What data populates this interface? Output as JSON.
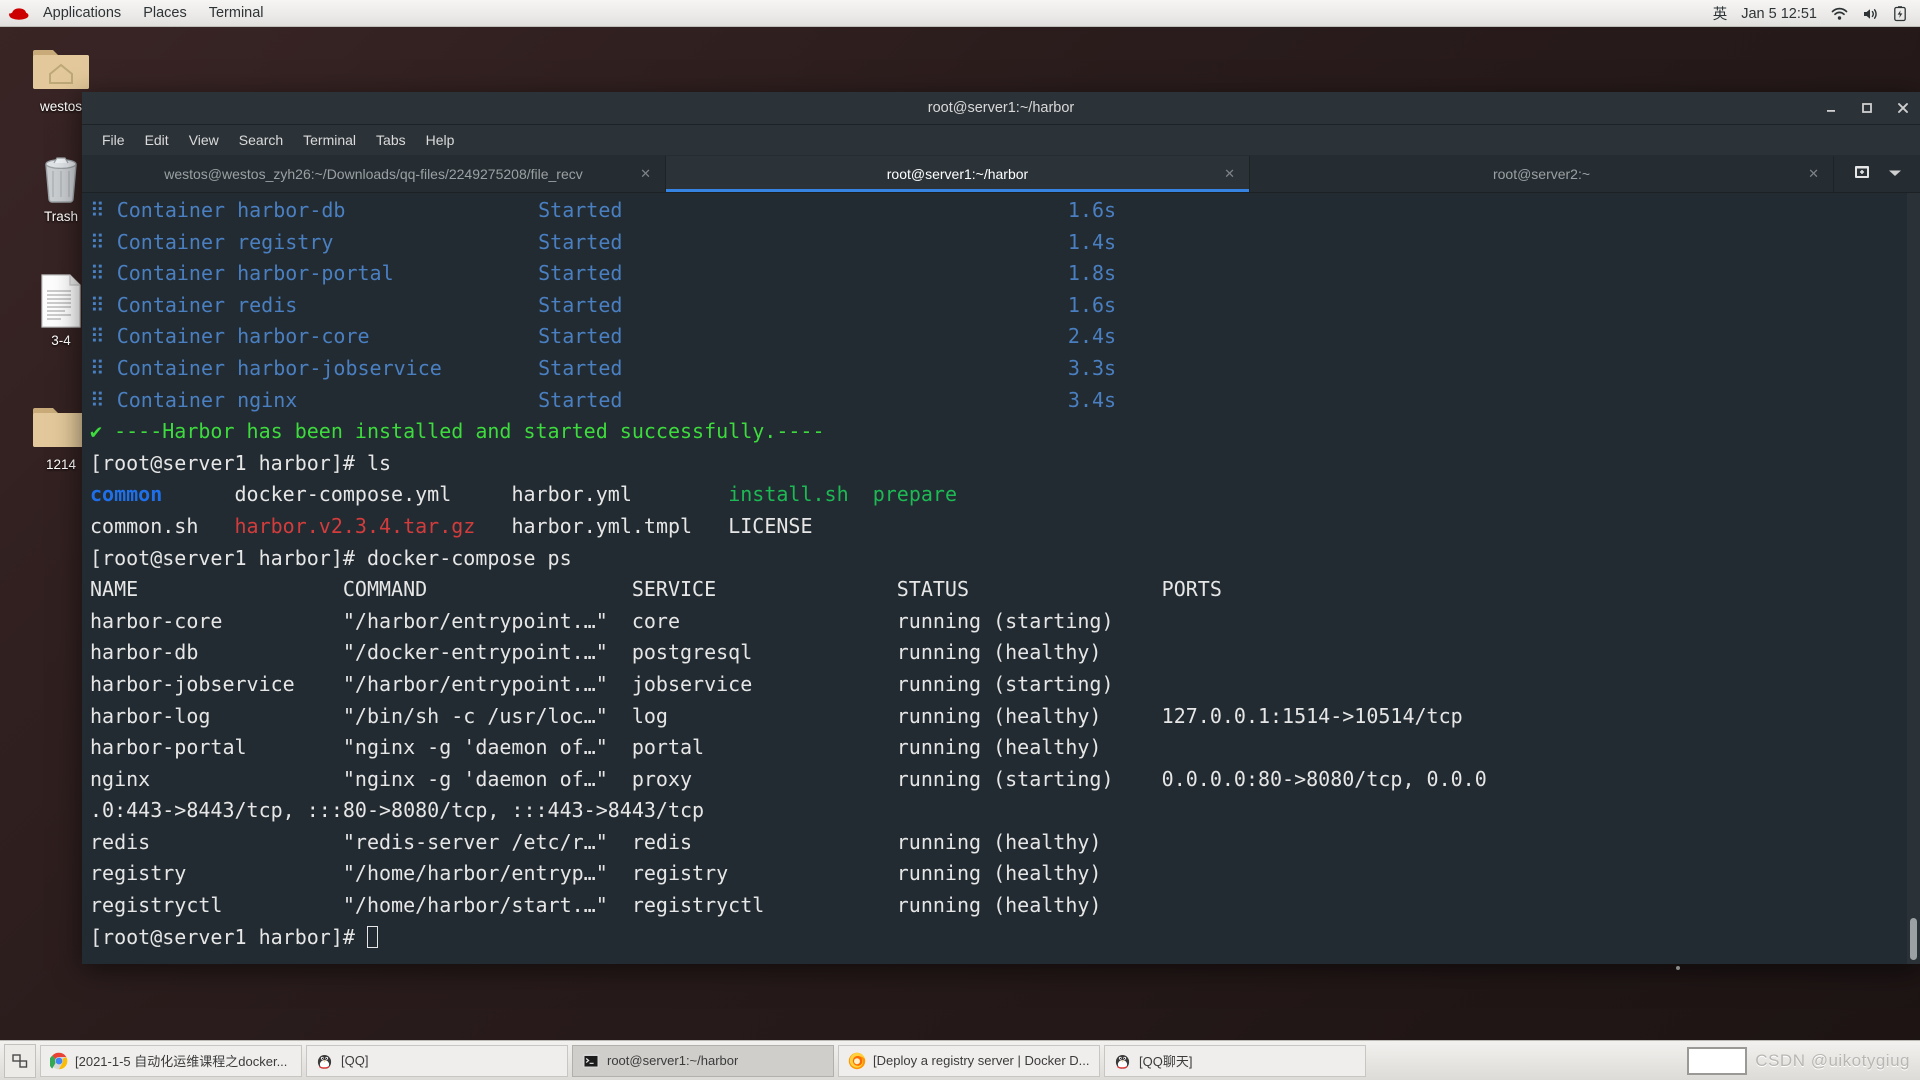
{
  "top_panel": {
    "logo_icon": "redhat-logo-icon",
    "menus": [
      "Applications",
      "Places",
      "Terminal"
    ],
    "input_method": "英",
    "clock": "Jan 5  12:51",
    "tray_icons": [
      "wifi-icon",
      "volume-icon",
      "battery-icon"
    ]
  },
  "desktop_icons": [
    {
      "label": "westos",
      "icon": "home-folder-icon"
    },
    {
      "label": "Trash",
      "icon": "trash-icon"
    },
    {
      "label": "3-4",
      "icon": "document-icon"
    },
    {
      "label": "1214",
      "icon": "folder-icon"
    }
  ],
  "window": {
    "title": "root@server1:~/harbor",
    "controls": {
      "minimize": "—",
      "maximize": "□",
      "close": "✕"
    },
    "menu_bar": [
      "File",
      "Edit",
      "View",
      "Search",
      "Terminal",
      "Tabs",
      "Help"
    ],
    "tabs": [
      {
        "label": "westos@westos_zyh26:~/Downloads/qq-files/2249275208/file_recv",
        "active": false,
        "close": "✕"
      },
      {
        "label": "root@server1:~/harbor",
        "active": true,
        "close": "✕"
      },
      {
        "label": "root@server2:~",
        "active": false,
        "close": "✕"
      }
    ],
    "tab_actions": [
      "new-tab-icon",
      "tab-list-chevron-icon"
    ]
  },
  "terminal": {
    "compose_up": [
      {
        "glyph": "⠿",
        "name": "Container harbor-db",
        "status": "Started",
        "time": "1.6s"
      },
      {
        "glyph": "⠿",
        "name": "Container registry",
        "status": "Started",
        "time": "1.4s"
      },
      {
        "glyph": "⠿",
        "name": "Container harbor-portal",
        "status": "Started",
        "time": "1.8s"
      },
      {
        "glyph": "⠿",
        "name": "Container redis",
        "status": "Started",
        "time": "1.6s"
      },
      {
        "glyph": "⠿",
        "name": "Container harbor-core",
        "status": "Started",
        "time": "2.4s"
      },
      {
        "glyph": "⠿",
        "name": "Container harbor-jobservice",
        "status": "Started",
        "time": "3.3s"
      },
      {
        "glyph": "⠿",
        "name": "Container nginx",
        "status": "Started",
        "time": "3.4s"
      }
    ],
    "success_line": {
      "check": "✔",
      "text": "----Harbor has been installed and started successfully.----"
    },
    "prompt": "[root@server1 harbor]#",
    "cmd_ls": "ls",
    "ls_row1": [
      {
        "text": "common",
        "color": "dir"
      },
      {
        "text": "docker-compose.yml",
        "color": "plain"
      },
      {
        "text": "harbor.yml",
        "color": "plain"
      },
      {
        "text": "install.sh",
        "color": "exec"
      },
      {
        "text": "prepare",
        "color": "exec"
      }
    ],
    "ls_row2": [
      {
        "text": "common.sh",
        "color": "plain"
      },
      {
        "text": "harbor.v2.3.4.tar.gz",
        "color": "archive"
      },
      {
        "text": "harbor.yml.tmpl",
        "color": "plain"
      },
      {
        "text": "LICENSE",
        "color": "plain"
      }
    ],
    "cmd_ps": "docker-compose ps",
    "ps_headers": [
      "NAME",
      "COMMAND",
      "SERVICE",
      "STATUS",
      "PORTS"
    ],
    "ps_rows": [
      {
        "name": "harbor-core",
        "command": "\"/harbor/entrypoint.…\"",
        "service": "core",
        "status": "running (starting)",
        "ports": ""
      },
      {
        "name": "harbor-db",
        "command": "\"/docker-entrypoint.…\"",
        "service": "postgresql",
        "status": "running (healthy)",
        "ports": ""
      },
      {
        "name": "harbor-jobservice",
        "command": "\"/harbor/entrypoint.…\"",
        "service": "jobservice",
        "status": "running (starting)",
        "ports": ""
      },
      {
        "name": "harbor-log",
        "command": "\"/bin/sh -c /usr/loc…\"",
        "service": "log",
        "status": "running (healthy)",
        "ports": "127.0.0.1:1514->10514/tcp"
      },
      {
        "name": "harbor-portal",
        "command": "\"nginx -g 'daemon of…\"",
        "service": "portal",
        "status": "running (healthy)",
        "ports": ""
      },
      {
        "name": "nginx",
        "command": "\"nginx -g 'daemon of…\"",
        "service": "proxy",
        "status": "running (starting)",
        "ports": "0.0.0.0:80->8080/tcp, 0.0.0"
      },
      {
        "name": "redis",
        "command": "\"redis-server /etc/r…\"",
        "service": "redis",
        "status": "running (healthy)",
        "ports": ""
      },
      {
        "name": "registry",
        "command": "\"/home/harbor/entryp…\"",
        "service": "registry",
        "status": "running (healthy)",
        "ports": ""
      },
      {
        "name": "registryctl",
        "command": "\"/home/harbor/start.…\"",
        "service": "registryctl",
        "status": "running (healthy)",
        "ports": ""
      }
    ],
    "ports_wrap_line": ".0:443->8443/tcp, :::80->8080/tcp, :::443->8443/tcp",
    "final_prompt": "[root@server1 harbor]#"
  },
  "taskbar": {
    "show_desktop_icon": "show-desktop-icon",
    "buttons": [
      {
        "label": "[2021-1-5 自动化运维课程之docker...",
        "icon": "chrome-icon",
        "active": false
      },
      {
        "label": "[QQ]",
        "icon": "qq-penguin-icon",
        "active": false
      },
      {
        "label": "root@server1:~/harbor",
        "icon": "terminal-icon",
        "active": true
      },
      {
        "label": "[Deploy a registry server | Docker D...",
        "icon": "firefox-icon",
        "active": false
      },
      {
        "label": "[QQ聊天]",
        "icon": "qq-penguin-icon",
        "active": false
      }
    ],
    "watermark": "CSDN @uikotygiug"
  },
  "colors": {
    "terminal_bg": "#222b31",
    "compose_blue": "#4a7fc1",
    "success_green": "#3ddb3d",
    "dir_blue": "#1f6fe8",
    "exec_green": "#1db954",
    "archive_red": "#d33c3c",
    "tab_accent": "#3584e4"
  }
}
